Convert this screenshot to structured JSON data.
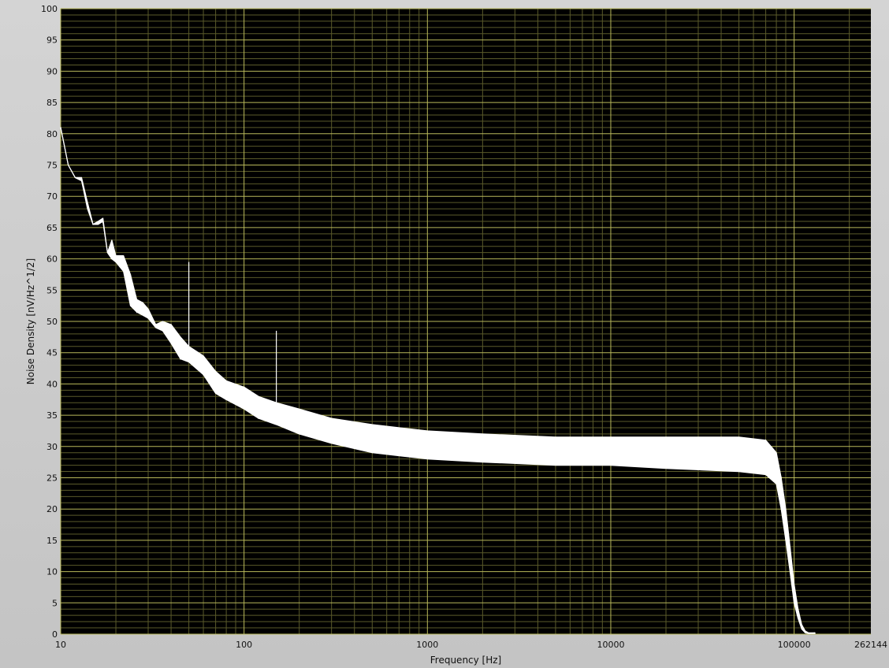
{
  "chart_data": {
    "type": "line",
    "xscale": "log",
    "xlim": [
      10,
      262144
    ],
    "ylim": [
      0,
      100
    ],
    "xlabel": "Frequency [Hz]",
    "ylabel": "Noise Density [nV/Hz^1/2]",
    "x_tick_labels": [
      "10",
      "100",
      "1000",
      "10000",
      "100000",
      "262144"
    ],
    "x_tick_values": [
      10,
      100,
      1000,
      10000,
      100000,
      262144
    ],
    "y_tick_labels": [
      "0",
      "5",
      "10",
      "15",
      "20",
      "25",
      "30",
      "35",
      "40",
      "45",
      "50",
      "55",
      "60",
      "65",
      "70",
      "75",
      "80",
      "85",
      "90",
      "95",
      "100"
    ],
    "y_tick_values": [
      0,
      5,
      10,
      15,
      20,
      25,
      30,
      35,
      40,
      45,
      50,
      55,
      60,
      65,
      70,
      75,
      80,
      85,
      90,
      95,
      100
    ],
    "grid": true,
    "colors": {
      "plot_background": "#000000",
      "major_grid": "#b8b85a",
      "minor_grid": "#5a5a2a",
      "trace": "#ffffff"
    },
    "series": [
      {
        "x": [
          10,
          11,
          12,
          13,
          14,
          15,
          16,
          17,
          18,
          19,
          20,
          22,
          24,
          26,
          28,
          30,
          33,
          36,
          40,
          45,
          50,
          60,
          70,
          80,
          100,
          120,
          150,
          200,
          300,
          500,
          1000,
          2000,
          5000,
          10000,
          20000,
          50000,
          70000,
          80000,
          85000,
          90000,
          95000,
          100000,
          105000,
          110000,
          115000,
          120000,
          130000
        ],
        "y_upper": [
          81,
          75,
          73,
          73,
          69,
          65.5,
          66,
          66.5,
          61,
          63,
          60.5,
          60.5,
          57.5,
          53.5,
          53,
          52,
          49.5,
          50,
          49.5,
          47.5,
          46,
          44.5,
          42,
          40.5,
          39.5,
          38,
          37,
          36,
          34.5,
          33.5,
          32.5,
          32,
          31.5,
          31.5,
          31.5,
          31.5,
          31,
          29,
          25,
          20,
          14,
          8,
          4,
          1.5,
          0.5,
          0.2,
          0.2
        ],
        "y_lower": [
          81,
          75,
          73,
          72.5,
          68,
          65.5,
          65.5,
          66,
          61,
          60,
          59.5,
          58,
          52.5,
          51.5,
          51,
          50.5,
          49,
          48.5,
          46.5,
          44,
          43.5,
          41.5,
          38.5,
          37.5,
          36,
          34.5,
          33.5,
          32,
          30.5,
          29,
          28,
          27.5,
          27,
          27,
          26.5,
          26,
          25.5,
          24,
          20,
          15,
          10,
          5,
          2.5,
          0.8,
          0.2,
          0.1,
          0.1
        ]
      }
    ],
    "spikes": [
      {
        "x": 50,
        "y": 59.5
      },
      {
        "x": 150,
        "y": 48.5
      }
    ]
  }
}
